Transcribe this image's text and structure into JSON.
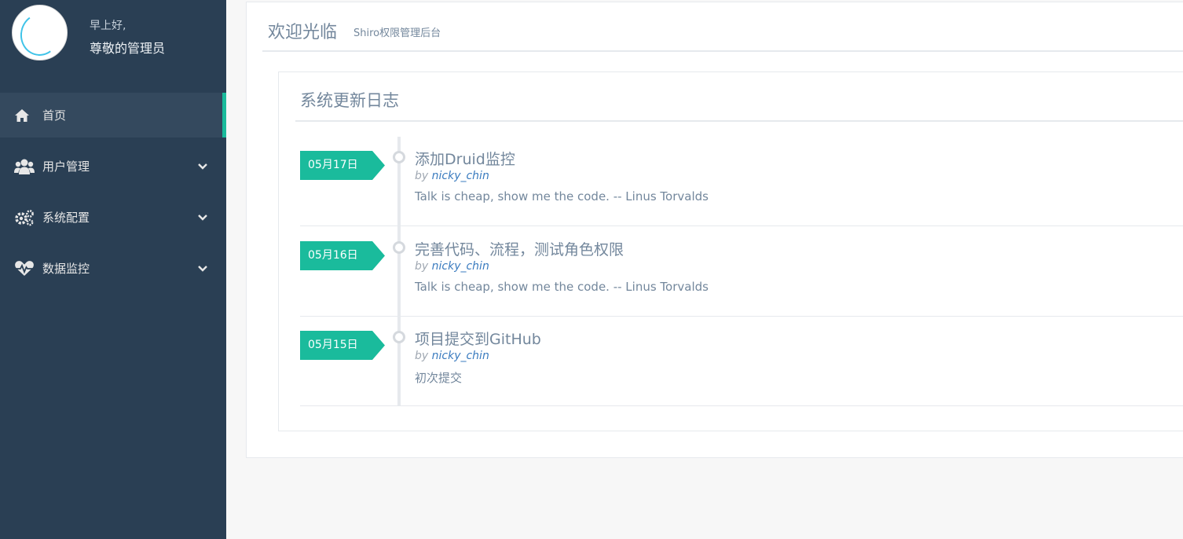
{
  "sidebar": {
    "profile": {
      "greeting": "早上好,",
      "name": "尊敬的管理员"
    },
    "items": [
      {
        "label": "首页",
        "icon": "home-icon",
        "active": true
      },
      {
        "label": "用户管理",
        "icon": "users-icon",
        "expandable": true
      },
      {
        "label": "系统配置",
        "icon": "cogs-icon",
        "expandable": true
      },
      {
        "label": "数据监控",
        "icon": "heartbeat-icon",
        "expandable": true
      }
    ]
  },
  "header": {
    "title": "欢迎光临",
    "subtitle": "Shiro权限管理后台"
  },
  "changelog": {
    "title": "系统更新日志",
    "by_label": "by",
    "entries": [
      {
        "date": "05月17日",
        "title": "添加Druid监控",
        "author": "nicky_chin",
        "body": "Talk is cheap, show me the code. -- Linus Torvalds"
      },
      {
        "date": "05月16日",
        "title": "完善代码、流程，测试角色权限",
        "author": "nicky_chin",
        "body": "Talk is cheap, show me the code. -- Linus Torvalds"
      },
      {
        "date": "05月15日",
        "title": "项目提交到GitHub",
        "author": "nicky_chin",
        "body": "初次提交"
      }
    ]
  },
  "colors": {
    "sidebar_bg": "#2a3f54",
    "accent": "#1abb9c",
    "text_muted": "#73879c",
    "link": "#3a7bbf"
  }
}
